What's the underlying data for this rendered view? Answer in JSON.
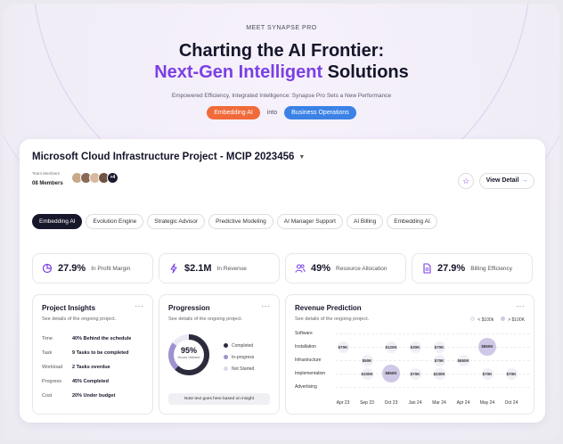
{
  "hero": {
    "eyebrow": "MEET SYNAPSE PRO",
    "title_line1": "Charting the AI Frontier:",
    "title_accent": "Next-Gen Intelligent",
    "title_rest": " Solutions",
    "subtitle": "Empowered Efficiency, Integrated Intelligence: Synapse Pro Sets a New Performance",
    "pill_left": "Embedding AI",
    "pill_into": "into",
    "pill_right": "Business Operations"
  },
  "project": {
    "title": "Microsoft Cloud Infrastructure Project - MCIP 2023456",
    "members_label": "Team Members",
    "members_count": "08 Members",
    "avatar_more": "+4",
    "view_detail": "View Detail"
  },
  "tabs": [
    {
      "label": "Embedding AI"
    },
    {
      "label": "Evolution Engine"
    },
    {
      "label": "Strategic Advisor"
    },
    {
      "label": "Predictive Modeling"
    },
    {
      "label": "AI Manager Support"
    },
    {
      "label": "AI Billing"
    },
    {
      "label": "Embedding AI"
    }
  ],
  "kpis": [
    {
      "value": "27.9%",
      "label": "In Profit Margin",
      "icon": "pie-chart-icon"
    },
    {
      "value": "$2.1M",
      "label": "In Revenue",
      "icon": "lightning-icon"
    },
    {
      "value": "49%",
      "label": "Resource Allocation",
      "icon": "users-icon"
    },
    {
      "value": "27.9%",
      "label": "Billing Efficiency",
      "icon": "document-icon"
    }
  ],
  "insights": {
    "title": "Project Insights",
    "subtitle": "See details of the ongoing project.",
    "rows": [
      {
        "key": "Time",
        "value": "40% Behind the schedule"
      },
      {
        "key": "Task",
        "value": "9 Tasks to be completed"
      },
      {
        "key": "Workload",
        "value": "2 Tasks overdue"
      },
      {
        "key": "Progress",
        "value": "45% Completed"
      },
      {
        "key": "Cost",
        "value": "20% Under budget"
      }
    ]
  },
  "progression": {
    "title": "Progression",
    "subtitle": "See details of the ongoing project.",
    "percent": "95%",
    "percent_label": "Hours Utilised",
    "legend": [
      "Completed",
      "In-progress",
      "Not Started"
    ],
    "note": "Note text goes here based on insight",
    "completed_fraction": 0.62,
    "inprogress_fraction": 0.23
  },
  "revenue": {
    "title": "Revenue Prediction",
    "subtitle": "See details of the ongoing project.",
    "legend_small": "< $100k",
    "legend_large": "> $100K",
    "rows": [
      "Software",
      "Installation",
      "Infrastructure",
      "Implementation",
      "Advertising"
    ],
    "cols": [
      "Apr 23",
      "Sep 23",
      "Oct 23",
      "Jan 24",
      "Mar 24",
      "Apr 24",
      "May 24",
      "Oct 24"
    ],
    "bubbles": [
      {
        "row": 1,
        "col": 0,
        "label": "$70K",
        "big": false
      },
      {
        "row": 1,
        "col": 2,
        "label": "$120K",
        "big": false
      },
      {
        "row": 1,
        "col": 3,
        "label": "$30K",
        "big": false
      },
      {
        "row": 1,
        "col": 4,
        "label": "$70K",
        "big": false
      },
      {
        "row": 1,
        "col": 6,
        "label": "$850K",
        "big": true
      },
      {
        "row": 2,
        "col": 1,
        "label": "$50K",
        "big": false
      },
      {
        "row": 2,
        "col": 4,
        "label": "$70K",
        "big": false
      },
      {
        "row": 2,
        "col": 5,
        "label": "$650K",
        "big": false
      },
      {
        "row": 3,
        "col": 1,
        "label": "$100K",
        "big": false
      },
      {
        "row": 3,
        "col": 2,
        "label": "$850K",
        "big": true
      },
      {
        "row": 3,
        "col": 3,
        "label": "$70K",
        "big": false
      },
      {
        "row": 3,
        "col": 4,
        "label": "$230K",
        "big": false
      },
      {
        "row": 3,
        "col": 6,
        "label": "$70K",
        "big": false
      },
      {
        "row": 3,
        "col": 7,
        "label": "$70K",
        "big": false
      }
    ]
  },
  "colors": {
    "accent": "#7b3fe4",
    "orange": "#f06a3a",
    "blue": "#3b82e6",
    "dark": "#17172b",
    "bubble_small": "#f1eff6",
    "bubble_big": "#cfc8e6"
  }
}
